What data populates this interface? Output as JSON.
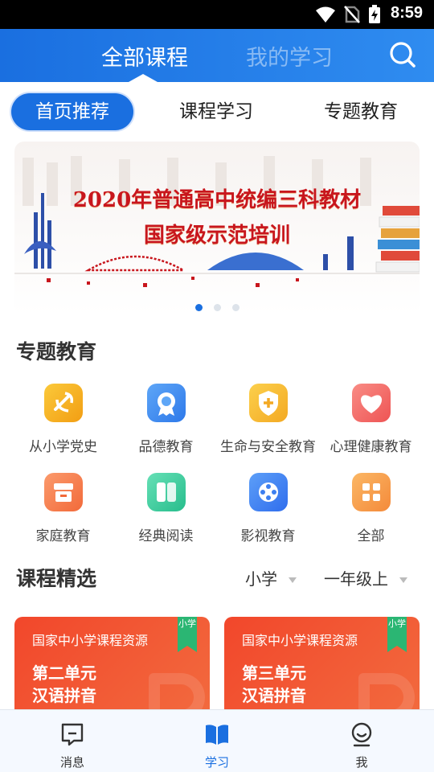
{
  "status_bar": {
    "time": "8:59"
  },
  "header": {
    "tabs": [
      {
        "label": "全部课程",
        "active": true
      },
      {
        "label": "我的学习",
        "active": false
      }
    ]
  },
  "sub_tabs": [
    {
      "label": "首页推荐",
      "active": true
    },
    {
      "label": "课程学习",
      "active": false
    },
    {
      "label": "专题教育",
      "active": false
    }
  ],
  "banner": {
    "line1": "2020年普通高中统编三科教材",
    "line2": "国家级示范培训",
    "slide_count": 3,
    "active_slide": 1
  },
  "topics": {
    "title": "专题教育",
    "items": [
      {
        "label": "从小学党史",
        "icon": "party-emblem-icon",
        "color": "#f7b21b"
      },
      {
        "label": "品德教育",
        "icon": "medal-icon",
        "color": "#3d8ef2"
      },
      {
        "label": "生命与安全教育",
        "icon": "shield-icon",
        "color": "#f6b62a"
      },
      {
        "label": "心理健康教育",
        "icon": "heart-icon",
        "color": "#f46a6a"
      },
      {
        "label": "家庭教育",
        "icon": "home-icon",
        "color": "#f6844f"
      },
      {
        "label": "经典阅读",
        "icon": "book-icon",
        "color": "#3ccf9e"
      },
      {
        "label": "影视教育",
        "icon": "film-reel-icon",
        "color": "#3d7ff0"
      },
      {
        "label": "全部",
        "icon": "grid-icon",
        "color": "#f7a04b"
      }
    ]
  },
  "courses": {
    "title": "课程精选",
    "filters": {
      "level": "小学",
      "grade": "一年级上"
    },
    "cards": [
      {
        "source": "国家中小学课程资源",
        "badge": "小学",
        "unit": "第二单元",
        "topic": "汉语拼音"
      },
      {
        "source": "国家中小学课程资源",
        "badge": "小学",
        "unit": "第三单元",
        "topic": "汉语拼音"
      }
    ]
  },
  "bottom_nav": [
    {
      "label": "消息",
      "icon": "message-icon",
      "active": false
    },
    {
      "label": "学习",
      "icon": "book-open-icon",
      "active": true
    },
    {
      "label": "我",
      "icon": "profile-icon",
      "active": false
    }
  ],
  "colors": {
    "primary": "#1a6fe0",
    "accent_red": "#c8161d",
    "card_orange": "#f2472b"
  }
}
